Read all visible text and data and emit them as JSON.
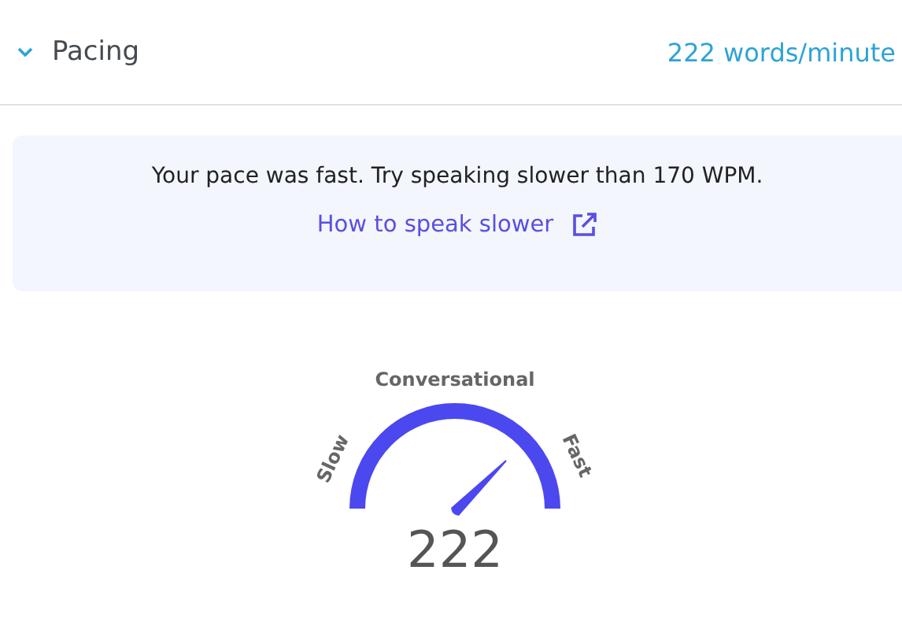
{
  "header": {
    "expanded": true,
    "title": "Pacing",
    "value": "222 words/minute"
  },
  "tip": {
    "message": "Your pace was fast. Try speaking slower than 170 WPM.",
    "link": "How to speak slower"
  },
  "gauge": {
    "top_label": "Conversational",
    "left_label": "Slow",
    "right_label": "Fast",
    "reading": "222"
  }
}
